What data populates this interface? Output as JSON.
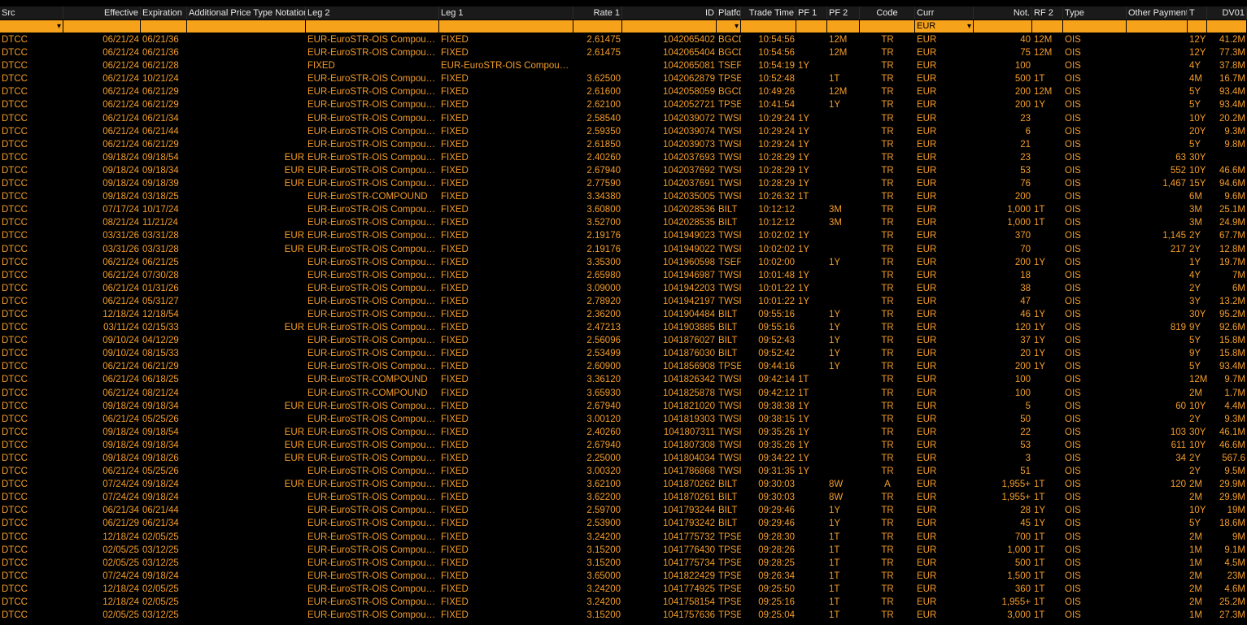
{
  "columns": [
    {
      "key": "src",
      "label": "Src"
    },
    {
      "key": "effective",
      "label": "Effective"
    },
    {
      "key": "expiration",
      "label": "Expiration"
    },
    {
      "key": "addl",
      "label": "Additional Price Type Notation"
    },
    {
      "key": "leg2",
      "label": "Leg 2"
    },
    {
      "key": "leg1",
      "label": "Leg 1"
    },
    {
      "key": "rate1",
      "label": "Rate 1"
    },
    {
      "key": "id",
      "label": "ID"
    },
    {
      "key": "platform",
      "label": "Platform ID"
    },
    {
      "key": "time",
      "label": "Trade Time"
    },
    {
      "key": "pf1",
      "label": "PF 1"
    },
    {
      "key": "pf2",
      "label": "PF 2"
    },
    {
      "key": "code",
      "label": "Code"
    },
    {
      "key": "curr",
      "label": "Curr"
    },
    {
      "key": "not",
      "label": "Not."
    },
    {
      "key": "rf2",
      "label": "RF 2"
    },
    {
      "key": "type",
      "label": "Type"
    },
    {
      "key": "other",
      "label": "Other Payment"
    },
    {
      "key": "t",
      "label": "T"
    },
    {
      "key": "dv01",
      "label": "DV01"
    }
  ],
  "filters": {
    "curr": "EUR"
  },
  "rows": [
    [
      "DTCC",
      "06/21/24",
      "06/21/36",
      "",
      "EUR-EuroSTR-OIS Compou…",
      "FIXED",
      "2.61475",
      "1042065402",
      "BGCD",
      "10:54:56",
      "",
      "12M",
      "TR",
      "EUR",
      "40",
      "12M",
      "OIS",
      "",
      "12Y",
      "41.2M"
    ],
    [
      "DTCC",
      "06/21/24",
      "06/21/36",
      "",
      "EUR-EuroSTR-OIS Compou…",
      "FIXED",
      "2.61475",
      "1042065404",
      "BGCD",
      "10:54:56",
      "",
      "12M",
      "TR",
      "EUR",
      "75",
      "12M",
      "OIS",
      "",
      "12Y",
      "77.3M"
    ],
    [
      "DTCC",
      "06/21/24",
      "06/21/28",
      "",
      "FIXED",
      "EUR-EuroSTR-OIS Compou…",
      "",
      "1042065081",
      "TSEF",
      "10:54:19",
      "1Y",
      "",
      "TR",
      "EUR",
      "100",
      "",
      "OIS",
      "",
      "4Y",
      "37.8M"
    ],
    [
      "DTCC",
      "06/21/24",
      "10/21/24",
      "",
      "EUR-EuroSTR-OIS Compou…",
      "FIXED",
      "3.62500",
      "1042062879",
      "TPSE",
      "10:52:48",
      "",
      "1T",
      "TR",
      "EUR",
      "500",
      "1T",
      "OIS",
      "",
      "4M",
      "16.7M"
    ],
    [
      "DTCC",
      "06/21/24",
      "06/21/29",
      "",
      "EUR-EuroSTR-OIS Compou…",
      "FIXED",
      "2.61600",
      "1042058059",
      "BGCD",
      "10:49:26",
      "",
      "12M",
      "TR",
      "EUR",
      "200",
      "12M",
      "OIS",
      "",
      "5Y",
      "93.4M"
    ],
    [
      "DTCC",
      "06/21/24",
      "06/21/29",
      "",
      "EUR-EuroSTR-OIS Compou…",
      "FIXED",
      "2.62100",
      "1042052721",
      "TPSE",
      "10:41:54",
      "",
      "1Y",
      "TR",
      "EUR",
      "200",
      "1Y",
      "OIS",
      "",
      "5Y",
      "93.4M"
    ],
    [
      "DTCC",
      "06/21/24",
      "06/21/34",
      "",
      "EUR-EuroSTR-OIS Compou…",
      "FIXED",
      "2.58540",
      "1042039072",
      "TWSF",
      "10:29:24",
      "1Y",
      "",
      "TR",
      "EUR",
      "23",
      "",
      "OIS",
      "",
      "10Y",
      "20.2M"
    ],
    [
      "DTCC",
      "06/21/24",
      "06/21/44",
      "",
      "EUR-EuroSTR-OIS Compou…",
      "FIXED",
      "2.59350",
      "1042039074",
      "TWSF",
      "10:29:24",
      "1Y",
      "",
      "TR",
      "EUR",
      "6",
      "",
      "OIS",
      "",
      "20Y",
      "9.3M"
    ],
    [
      "DTCC",
      "06/21/24",
      "06/21/29",
      "",
      "EUR-EuroSTR-OIS Compou…",
      "FIXED",
      "2.61850",
      "1042039073",
      "TWSF",
      "10:29:24",
      "1Y",
      "",
      "TR",
      "EUR",
      "21",
      "",
      "OIS",
      "",
      "5Y",
      "9.8M"
    ],
    [
      "DTCC",
      "09/18/24",
      "09/18/54",
      "EUR",
      "EUR-EuroSTR-OIS Compou…",
      "FIXED",
      "2.40260",
      "1042037693",
      "TWSF",
      "10:28:29",
      "1Y",
      "",
      "TR",
      "EUR",
      "23",
      "",
      "OIS",
      "63",
      "30Y",
      ""
    ],
    [
      "DTCC",
      "09/18/24",
      "09/18/34",
      "EUR",
      "EUR-EuroSTR-OIS Compou…",
      "FIXED",
      "2.67940",
      "1042037692",
      "TWSF",
      "10:28:29",
      "1Y",
      "",
      "TR",
      "EUR",
      "53",
      "",
      "OIS",
      "552",
      "10Y",
      "46.6M"
    ],
    [
      "DTCC",
      "09/18/24",
      "09/18/39",
      "EUR",
      "EUR-EuroSTR-OIS Compou…",
      "FIXED",
      "2.77590",
      "1042037691",
      "TWSF",
      "10:28:29",
      "1Y",
      "",
      "TR",
      "EUR",
      "76",
      "",
      "OIS",
      "1,467",
      "15Y",
      "94.6M"
    ],
    [
      "DTCC",
      "09/18/24",
      "03/18/25",
      "",
      "EUR-EuroSTR-COMPOUND",
      "FIXED",
      "3.34380",
      "1042035005",
      "TWSF",
      "10:26:32",
      "1T",
      "",
      "TR",
      "EUR",
      "200",
      "",
      "OIS",
      "",
      "6M",
      "9.6M"
    ],
    [
      "DTCC",
      "07/17/24",
      "10/17/24",
      "",
      "EUR-EuroSTR-OIS Compou…",
      "FIXED",
      "3.60800",
      "1042028536",
      "BILT",
      "10:12:12",
      "",
      "3M",
      "TR",
      "EUR",
      "1,000",
      "1T",
      "OIS",
      "",
      "3M",
      "25.1M"
    ],
    [
      "DTCC",
      "08/21/24",
      "11/21/24",
      "",
      "EUR-EuroSTR-OIS Compou…",
      "FIXED",
      "3.52700",
      "1042028535",
      "BILT",
      "10:12:12",
      "",
      "3M",
      "TR",
      "EUR",
      "1,000",
      "1T",
      "OIS",
      "",
      "3M",
      "24.9M"
    ],
    [
      "DTCC",
      "03/31/26",
      "03/31/28",
      "EUR",
      "EUR-EuroSTR-OIS Compou…",
      "FIXED",
      "2.19176",
      "1041949023",
      "TWSF",
      "10:02:02",
      "1Y",
      "",
      "TR",
      "EUR",
      "370",
      "",
      "OIS",
      "1,145",
      "2Y",
      "67.7M"
    ],
    [
      "DTCC",
      "03/31/26",
      "03/31/28",
      "EUR",
      "EUR-EuroSTR-OIS Compou…",
      "FIXED",
      "2.19176",
      "1041949022",
      "TWSF",
      "10:02:02",
      "1Y",
      "",
      "TR",
      "EUR",
      "70",
      "",
      "OIS",
      "217",
      "2Y",
      "12.8M"
    ],
    [
      "DTCC",
      "06/21/24",
      "06/21/25",
      "",
      "EUR-EuroSTR-OIS Compou…",
      "FIXED",
      "3.35300",
      "1041960598",
      "TSEF",
      "10:02:00",
      "",
      "1Y",
      "TR",
      "EUR",
      "200",
      "1Y",
      "OIS",
      "",
      "1Y",
      "19.7M"
    ],
    [
      "DTCC",
      "06/21/24",
      "07/30/28",
      "",
      "EUR-EuroSTR-OIS Compou…",
      "FIXED",
      "2.65980",
      "1041946987",
      "TWSF",
      "10:01:48",
      "1Y",
      "",
      "TR",
      "EUR",
      "18",
      "",
      "OIS",
      "",
      "4Y",
      "7M"
    ],
    [
      "DTCC",
      "06/21/24",
      "01/31/26",
      "",
      "EUR-EuroSTR-OIS Compou…",
      "FIXED",
      "3.09000",
      "1041942203",
      "TWSF",
      "10:01:22",
      "1Y",
      "",
      "TR",
      "EUR",
      "38",
      "",
      "OIS",
      "",
      "2Y",
      "6M"
    ],
    [
      "DTCC",
      "06/21/24",
      "05/31/27",
      "",
      "EUR-EuroSTR-OIS Compou…",
      "FIXED",
      "2.78920",
      "1041942197",
      "TWSF",
      "10:01:22",
      "1Y",
      "",
      "TR",
      "EUR",
      "47",
      "",
      "OIS",
      "",
      "3Y",
      "13.2M"
    ],
    [
      "DTCC",
      "12/18/24",
      "12/18/54",
      "",
      "EUR-EuroSTR-OIS Compou…",
      "FIXED",
      "2.36200",
      "1041904484",
      "BILT",
      "09:55:16",
      "",
      "1Y",
      "TR",
      "EUR",
      "46",
      "1Y",
      "OIS",
      "",
      "30Y",
      "95.2M"
    ],
    [
      "DTCC",
      "03/11/24",
      "02/15/33",
      "EUR",
      "EUR-EuroSTR-OIS Compou…",
      "FIXED",
      "2.47213",
      "1041903885",
      "BILT",
      "09:55:16",
      "",
      "1Y",
      "TR",
      "EUR",
      "120",
      "1Y",
      "OIS",
      "819",
      "9Y",
      "92.6M"
    ],
    [
      "DTCC",
      "09/10/24",
      "04/12/29",
      "",
      "EUR-EuroSTR-OIS Compou…",
      "FIXED",
      "2.56096",
      "1041876027",
      "BILT",
      "09:52:43",
      "",
      "1Y",
      "TR",
      "EUR",
      "37",
      "1Y",
      "OIS",
      "",
      "5Y",
      "15.8M"
    ],
    [
      "DTCC",
      "09/10/24",
      "08/15/33",
      "",
      "EUR-EuroSTR-OIS Compou…",
      "FIXED",
      "2.53499",
      "1041876030",
      "BILT",
      "09:52:42",
      "",
      "1Y",
      "TR",
      "EUR",
      "20",
      "1Y",
      "OIS",
      "",
      "9Y",
      "15.8M"
    ],
    [
      "DTCC",
      "06/21/24",
      "06/21/29",
      "",
      "EUR-EuroSTR-OIS Compou…",
      "FIXED",
      "2.60900",
      "1041856908",
      "TPSE",
      "09:44:16",
      "",
      "1Y",
      "TR",
      "EUR",
      "200",
      "1Y",
      "OIS",
      "",
      "5Y",
      "93.4M"
    ],
    [
      "DTCC",
      "06/21/24",
      "06/18/25",
      "",
      "EUR-EuroSTR-COMPOUND",
      "FIXED",
      "3.36120",
      "1041826342",
      "TWSF",
      "09:42:14",
      "1T",
      "",
      "TR",
      "EUR",
      "100",
      "",
      "OIS",
      "",
      "12M",
      "9.7M"
    ],
    [
      "DTCC",
      "06/21/24",
      "08/21/24",
      "",
      "EUR-EuroSTR-COMPOUND",
      "FIXED",
      "3.65930",
      "1041825878",
      "TWSF",
      "09:42:12",
      "1T",
      "",
      "TR",
      "EUR",
      "100",
      "",
      "OIS",
      "",
      "2M",
      "1.7M"
    ],
    [
      "DTCC",
      "09/18/24",
      "09/18/34",
      "EUR",
      "EUR-EuroSTR-OIS Compou…",
      "FIXED",
      "2.67940",
      "1041821020",
      "TWSF",
      "09:38:38",
      "1Y",
      "",
      "TR",
      "EUR",
      "5",
      "",
      "OIS",
      "60",
      "10Y",
      "4.4M"
    ],
    [
      "DTCC",
      "06/21/24",
      "05/25/26",
      "",
      "EUR-EuroSTR-OIS Compou…",
      "FIXED",
      "3.00120",
      "1041819303",
      "TWSF",
      "09:38:15",
      "1Y",
      "",
      "TR",
      "EUR",
      "50",
      "",
      "OIS",
      "",
      "2Y",
      "9.3M"
    ],
    [
      "DTCC",
      "09/18/24",
      "09/18/54",
      "EUR",
      "EUR-EuroSTR-OIS Compou…",
      "FIXED",
      "2.40260",
      "1041807311",
      "TWSF",
      "09:35:26",
      "1Y",
      "",
      "TR",
      "EUR",
      "22",
      "",
      "OIS",
      "103",
      "30Y",
      "46.1M"
    ],
    [
      "DTCC",
      "09/18/24",
      "09/18/34",
      "EUR",
      "EUR-EuroSTR-OIS Compou…",
      "FIXED",
      "2.67940",
      "1041807308",
      "TWSF",
      "09:35:26",
      "1Y",
      "",
      "TR",
      "EUR",
      "53",
      "",
      "OIS",
      "611",
      "10Y",
      "46.6M"
    ],
    [
      "DTCC",
      "09/18/24",
      "09/18/26",
      "EUR",
      "EUR-EuroSTR-OIS Compou…",
      "FIXED",
      "2.25000",
      "1041804034",
      "TWSF",
      "09:34:22",
      "1Y",
      "",
      "TR",
      "EUR",
      "3",
      "",
      "OIS",
      "34",
      "2Y",
      "567.6"
    ],
    [
      "DTCC",
      "06/21/24",
      "05/25/26",
      "",
      "EUR-EuroSTR-OIS Compou…",
      "FIXED",
      "3.00320",
      "1041786868",
      "TWSF",
      "09:31:35",
      "1Y",
      "",
      "TR",
      "EUR",
      "51",
      "",
      "OIS",
      "",
      "2Y",
      "9.5M"
    ],
    [
      "DTCC",
      "07/24/24",
      "09/18/24",
      "EUR",
      "EUR-EuroSTR-OIS Compou…",
      "FIXED",
      "3.62100",
      "1041870262",
      "BILT",
      "09:30:03",
      "",
      "8W",
      "A",
      "EUR",
      "1,955+",
      "1T",
      "OIS",
      "120",
      "2M",
      "29.9M"
    ],
    [
      "DTCC",
      "07/24/24",
      "09/18/24",
      "",
      "EUR-EuroSTR-OIS Compou…",
      "FIXED",
      "3.62200",
      "1041870261",
      "BILT",
      "09:30:03",
      "",
      "8W",
      "TR",
      "EUR",
      "1,955+",
      "1T",
      "OIS",
      "",
      "2M",
      "29.9M"
    ],
    [
      "DTCC",
      "06/21/34",
      "06/21/44",
      "",
      "EUR-EuroSTR-OIS Compou…",
      "FIXED",
      "2.59700",
      "1041793244",
      "BILT",
      "09:29:46",
      "",
      "1Y",
      "TR",
      "EUR",
      "28",
      "1Y",
      "OIS",
      "",
      "10Y",
      "19M"
    ],
    [
      "DTCC",
      "06/21/29",
      "06/21/34",
      "",
      "EUR-EuroSTR-OIS Compou…",
      "FIXED",
      "2.53900",
      "1041793242",
      "BILT",
      "09:29:46",
      "",
      "1Y",
      "TR",
      "EUR",
      "45",
      "1Y",
      "OIS",
      "",
      "5Y",
      "18.6M"
    ],
    [
      "DTCC",
      "12/18/24",
      "02/05/25",
      "",
      "EUR-EuroSTR-OIS Compou…",
      "FIXED",
      "3.24200",
      "1041775732",
      "TPSE",
      "09:28:30",
      "",
      "1T",
      "TR",
      "EUR",
      "700",
      "1T",
      "OIS",
      "",
      "2M",
      "9M"
    ],
    [
      "DTCC",
      "02/05/25",
      "03/12/25",
      "",
      "EUR-EuroSTR-OIS Compou…",
      "FIXED",
      "3.15200",
      "1041776430",
      "TPSE",
      "09:28:26",
      "",
      "1T",
      "TR",
      "EUR",
      "1,000",
      "1T",
      "OIS",
      "",
      "1M",
      "9.1M"
    ],
    [
      "DTCC",
      "02/05/25",
      "03/12/25",
      "",
      "EUR-EuroSTR-OIS Compou…",
      "FIXED",
      "3.15200",
      "1041775734",
      "TPSE",
      "09:28:25",
      "",
      "1T",
      "TR",
      "EUR",
      "500",
      "1T",
      "OIS",
      "",
      "1M",
      "4.5M"
    ],
    [
      "DTCC",
      "07/24/24",
      "09/18/24",
      "",
      "EUR-EuroSTR-OIS Compou…",
      "FIXED",
      "3.65000",
      "1041822429",
      "TPSE",
      "09:26:34",
      "",
      "1T",
      "TR",
      "EUR",
      "1,500",
      "1T",
      "OIS",
      "",
      "2M",
      "23M"
    ],
    [
      "DTCC",
      "12/18/24",
      "02/05/25",
      "",
      "EUR-EuroSTR-OIS Compou…",
      "FIXED",
      "3.24200",
      "1041774925",
      "TPSE",
      "09:25:50",
      "",
      "1T",
      "TR",
      "EUR",
      "360",
      "1T",
      "OIS",
      "",
      "2M",
      "4.6M"
    ],
    [
      "DTCC",
      "12/18/24",
      "02/05/25",
      "",
      "EUR-EuroSTR-OIS Compou…",
      "FIXED",
      "3.24200",
      "1041758154",
      "TPSE",
      "09:25:16",
      "",
      "1T",
      "TR",
      "EUR",
      "1,955+",
      "1T",
      "OIS",
      "",
      "2M",
      "25.2M"
    ],
    [
      "DTCC",
      "02/05/25",
      "03/12/25",
      "",
      "EUR-EuroSTR-OIS Compou…",
      "FIXED",
      "3.15200",
      "1041757636",
      "TPSE",
      "09:25:04",
      "",
      "1T",
      "TR",
      "EUR",
      "3,000",
      "1T",
      "OIS",
      "",
      "1M",
      "27.3M"
    ]
  ]
}
